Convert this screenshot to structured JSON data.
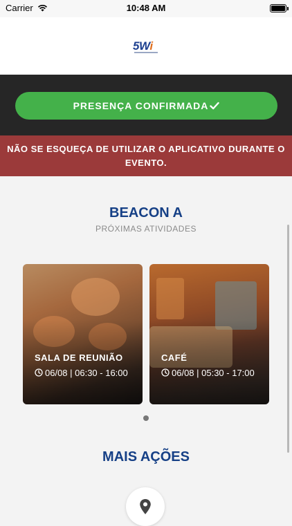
{
  "status_bar": {
    "carrier": "Carrier",
    "time": "10:48 AM",
    "icons": [
      "wifi-icon",
      "battery-icon"
    ]
  },
  "header": {
    "logo_text": "5W",
    "logo_accent": "i",
    "brand_color": "#1c3f8f",
    "accent_color": "#e07020"
  },
  "event": {
    "confirm_label": "PRESENÇA CONFIRMADA",
    "confirm_icon": "check-icon",
    "confirm_color": "#44b14a",
    "warning": "NÃO SE ESQUEÇA DE UTILIZAR O APLICATIVO DURANTE O EVENTO.",
    "warning_color": "#9b3a3a"
  },
  "beacon": {
    "title": "BEACON A",
    "subtitle": "PRÓXIMAS ATIVIDADES",
    "activities": [
      {
        "title": "SALA DE REUNIÃO",
        "time": "06/08 | 06:30 - 16:00",
        "icon": "clock-icon"
      },
      {
        "title": "CAFÉ",
        "time": "06/08 | 05:30 - 17:00",
        "icon": "clock-icon"
      }
    ]
  },
  "more_actions": {
    "title": "MAIS AÇÕES",
    "items": [
      {
        "icon": "location-pin-icon"
      }
    ]
  }
}
